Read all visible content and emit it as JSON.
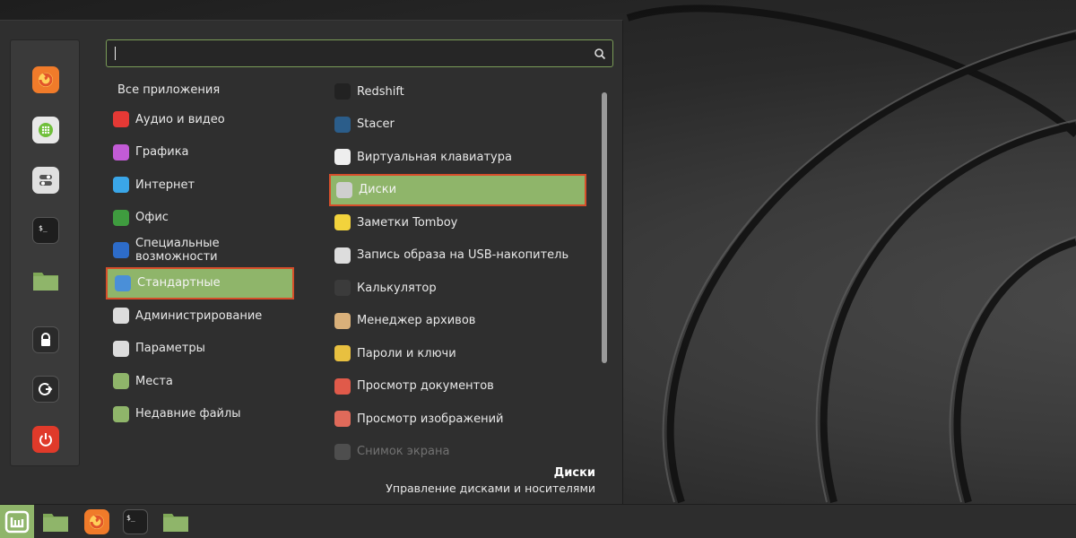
{
  "search": {
    "value": "",
    "placeholder": ""
  },
  "favorites": [
    {
      "name": "firefox-icon"
    },
    {
      "name": "software-manager-icon"
    },
    {
      "name": "settings-icon"
    },
    {
      "name": "terminal-icon"
    },
    {
      "name": "folder-icon"
    },
    {
      "name": "lock-icon"
    },
    {
      "name": "logout-icon"
    },
    {
      "name": "power-icon"
    }
  ],
  "categories": {
    "header": "Все приложения",
    "items": [
      {
        "label": "Аудио и видео",
        "icon": "multimedia-icon",
        "color": "#e53935"
      },
      {
        "label": "Графика",
        "icon": "graphics-icon",
        "color": "#c25bd6"
      },
      {
        "label": "Интернет",
        "icon": "internet-icon",
        "color": "#3aa6e8"
      },
      {
        "label": "Офис",
        "icon": "office-icon",
        "color": "#3f9c3f"
      },
      {
        "label": "Специальные возможности",
        "icon": "accessibility-icon",
        "color": "#2d6cc9"
      },
      {
        "label": "Стандартные",
        "icon": "accessories-icon",
        "color": "#4a8fd8",
        "selected": true
      },
      {
        "label": "Администрирование",
        "icon": "administration-icon",
        "color": "#dcdcdc"
      },
      {
        "label": "Параметры",
        "icon": "preferences-icon",
        "color": "#dcdcdc"
      },
      {
        "label": "Места",
        "icon": "places-icon",
        "color": "#8fb56a"
      },
      {
        "label": "Недавние файлы",
        "icon": "recent-files-icon",
        "color": "#8fb56a"
      }
    ]
  },
  "apps": [
    {
      "label": "Redshift",
      "icon": "redshift-icon",
      "color": "#222222"
    },
    {
      "label": "Stacer",
      "icon": "stacer-icon",
      "color": "#2b5d8a"
    },
    {
      "label": "Виртуальная клавиатура",
      "icon": "keyboard-icon",
      "color": "#eeeeee"
    },
    {
      "label": "Диски",
      "icon": "disks-icon",
      "color": "#cfcfcf",
      "selected": true
    },
    {
      "label": "Заметки Tomboy",
      "icon": "tomboy-icon",
      "color": "#f2d33c"
    },
    {
      "label": "Запись образа на USB-накопитель",
      "icon": "usb-icon",
      "color": "#dddddd"
    },
    {
      "label": "Калькулятор",
      "icon": "calculator-icon",
      "color": "#3b3b3b"
    },
    {
      "label": "Менеджер архивов",
      "icon": "archive-icon",
      "color": "#d9b07a"
    },
    {
      "label": "Пароли и ключи",
      "icon": "keys-icon",
      "color": "#e8c040"
    },
    {
      "label": "Просмотр документов",
      "icon": "document-viewer-icon",
      "color": "#e05a4a"
    },
    {
      "label": "Просмотр изображений",
      "icon": "image-viewer-icon",
      "color": "#e06a5a"
    },
    {
      "label": "Снимок экрана",
      "icon": "screenshot-icon",
      "color": "#8a8a8a",
      "faded": true
    }
  ],
  "description": {
    "title": "Диски",
    "text": "Управление дисками и носителями"
  },
  "taskbar": {
    "items": [
      "menu-icon",
      "file-manager-icon",
      "firefox-icon",
      "terminal-icon",
      "folder-icon"
    ]
  },
  "colors": {
    "accent": "#8fb56a",
    "selection_border": "#d64e2a",
    "panel": "#2f2f2f"
  }
}
